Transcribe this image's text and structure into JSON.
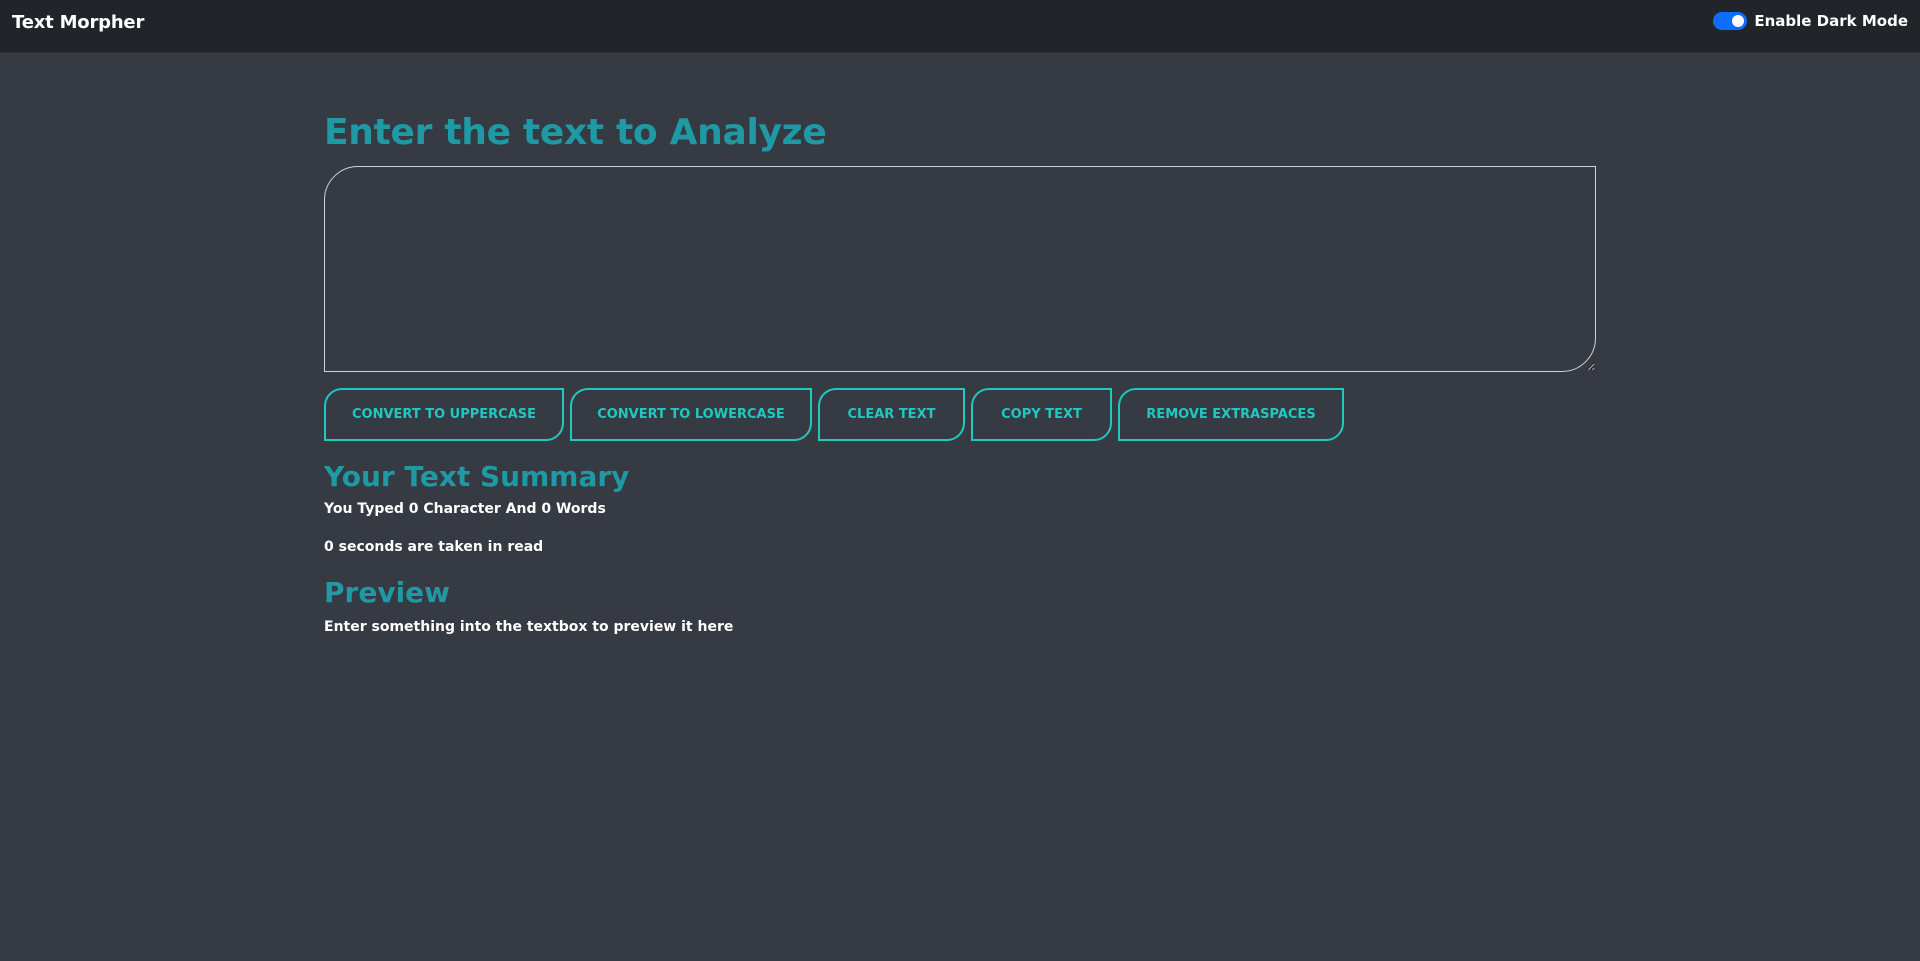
{
  "navbar": {
    "brand": "Text Morpher",
    "dark_mode_label": "Enable Dark Mode",
    "dark_mode_enabled": true
  },
  "main": {
    "heading": "Enter the text to Analyze",
    "textarea_value": "",
    "buttons": {
      "uppercase": "CONVERT TO UPPERCASE",
      "lowercase": "CONVERT TO LOWERCASE",
      "clear": "CLEAR TEXT",
      "copy": "COPY TEXT",
      "extraspaces": "REMOVE EXTRASPACES"
    }
  },
  "summary": {
    "heading": "Your Text Summary",
    "counts": "You Typed 0 Character And 0 Words",
    "read_time": "0 seconds are taken in read"
  },
  "preview": {
    "heading": "Preview",
    "text": "Enter something into the textbox to preview it here"
  },
  "colors": {
    "background": "#363a42",
    "navbar": "#212529",
    "accent_heading": "#1f9aa5",
    "accent_button": "#20c9c0",
    "toggle": "#0d6efd"
  }
}
